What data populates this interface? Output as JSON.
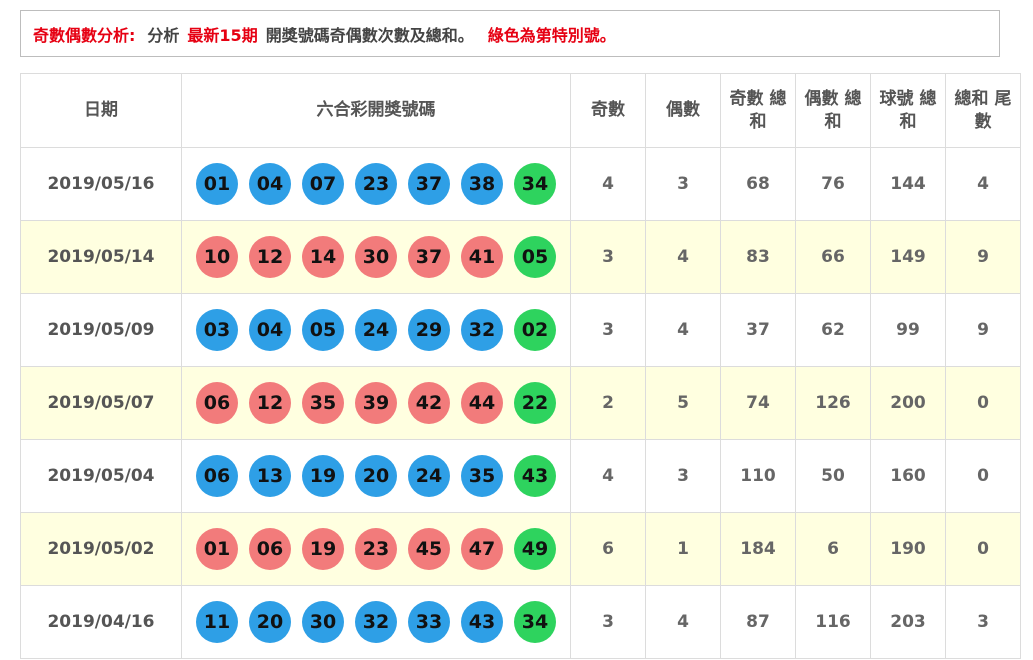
{
  "notice": {
    "label": "奇數偶數分析:",
    "text1": "分析",
    "highlight": "最新15期",
    "text2": "開獎號碼奇偶數次數及總和。",
    "note": "綠色為第特別號。"
  },
  "colors": {
    "blue": "#2e9fe6",
    "red": "#f27b7b",
    "green": "#2ed35e"
  },
  "table": {
    "headers": [
      "日期",
      "六合彩開獎號碼",
      "奇數",
      "偶數",
      "奇數 總和",
      "偶數 總和",
      "球號 總和",
      "總和 尾數"
    ],
    "rows": [
      {
        "date": "2019/05/16",
        "color": "blue",
        "balls": [
          "01",
          "04",
          "07",
          "23",
          "37",
          "38",
          "34"
        ],
        "odd": "4",
        "even": "3",
        "odd_sum": "68",
        "even_sum": "76",
        "total": "144",
        "tail": "4"
      },
      {
        "date": "2019/05/14",
        "color": "red",
        "balls": [
          "10",
          "12",
          "14",
          "30",
          "37",
          "41",
          "05"
        ],
        "odd": "3",
        "even": "4",
        "odd_sum": "83",
        "even_sum": "66",
        "total": "149",
        "tail": "9"
      },
      {
        "date": "2019/05/09",
        "color": "blue",
        "balls": [
          "03",
          "04",
          "05",
          "24",
          "29",
          "32",
          "02"
        ],
        "odd": "3",
        "even": "4",
        "odd_sum": "37",
        "even_sum": "62",
        "total": "99",
        "tail": "9"
      },
      {
        "date": "2019/05/07",
        "color": "red",
        "balls": [
          "06",
          "12",
          "35",
          "39",
          "42",
          "44",
          "22"
        ],
        "odd": "2",
        "even": "5",
        "odd_sum": "74",
        "even_sum": "126",
        "total": "200",
        "tail": "0"
      },
      {
        "date": "2019/05/04",
        "color": "blue",
        "balls": [
          "06",
          "13",
          "19",
          "20",
          "24",
          "35",
          "43"
        ],
        "odd": "4",
        "even": "3",
        "odd_sum": "110",
        "even_sum": "50",
        "total": "160",
        "tail": "0"
      },
      {
        "date": "2019/05/02",
        "color": "red",
        "balls": [
          "01",
          "06",
          "19",
          "23",
          "45",
          "47",
          "49"
        ],
        "odd": "6",
        "even": "1",
        "odd_sum": "184",
        "even_sum": "6",
        "total": "190",
        "tail": "0"
      },
      {
        "date": "2019/04/16",
        "color": "blue",
        "balls": [
          "11",
          "20",
          "30",
          "32",
          "33",
          "43",
          "34"
        ],
        "odd": "3",
        "even": "4",
        "odd_sum": "87",
        "even_sum": "116",
        "total": "203",
        "tail": "3"
      }
    ]
  }
}
